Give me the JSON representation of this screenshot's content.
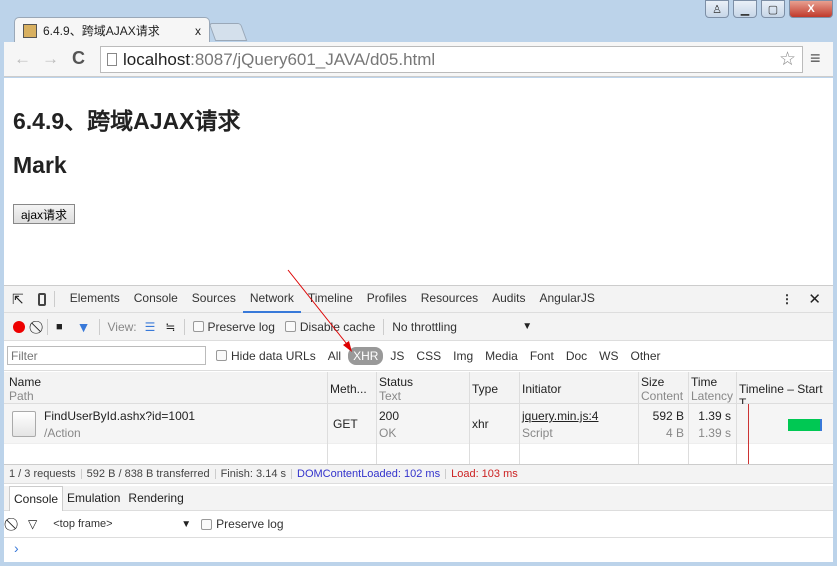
{
  "browser": {
    "tab_title": "6.4.9、跨域AJAX请求",
    "tab_close": "x",
    "url_host": "localhost",
    "url_rest": ":8087/jQuery601_JAVA/d05.html"
  },
  "page": {
    "heading1": "6.4.9、跨域AJAX请求",
    "heading2": "Mark",
    "button": "ajax请求"
  },
  "devtools": {
    "tabs": [
      "Elements",
      "Console",
      "Sources",
      "Network",
      "Timeline",
      "Profiles",
      "Resources",
      "Audits",
      "AngularJS"
    ],
    "active_tab": "Network",
    "view_label": "View:",
    "preserve_log": "Preserve log",
    "disable_cache": "Disable cache",
    "throttling": "No throttling",
    "filter_placeholder": "Filter",
    "hide_data_urls": "Hide data URLs",
    "types": [
      "All",
      "XHR",
      "JS",
      "CSS",
      "Img",
      "Media",
      "Font",
      "Doc",
      "WS",
      "Other"
    ],
    "active_type": "XHR",
    "columns": [
      {
        "main": "Name",
        "sub": "Path"
      },
      {
        "main": "Meth...",
        "sub": ""
      },
      {
        "main": "Status",
        "sub": "Text"
      },
      {
        "main": "Type",
        "sub": ""
      },
      {
        "main": "Initiator",
        "sub": ""
      },
      {
        "main": "Size",
        "sub": "Content"
      },
      {
        "main": "Time",
        "sub": "Latency"
      },
      {
        "main": "Timeline – Start T",
        "sub": ""
      }
    ],
    "rows": [
      {
        "name": "FindUserById.ashx?id=1001",
        "path": "/Action",
        "method": "GET",
        "status": "200",
        "status_text": "OK",
        "type": "xhr",
        "initiator": "jquery.min.js:4",
        "initiator_type": "Script",
        "size": "592 B",
        "content": "4 B",
        "time": "1.39 s",
        "latency": "1.39 s"
      }
    ],
    "status": {
      "requests": "1 / 3 requests",
      "transferred": "592 B / 838 B transferred",
      "finish": "Finish: 3.14 s",
      "dcl": "DOMContentLoaded: 102 ms",
      "load": "Load: 103 ms"
    },
    "drawer_tabs": [
      "Console",
      "Emulation",
      "Rendering"
    ],
    "frame_select": "<top frame>",
    "console_preserve": "Preserve log",
    "prompt": "›"
  },
  "colors": {
    "accent": "#3879d9",
    "dcl": "#3333cc",
    "load": "#cc2222",
    "bar": "#00c853"
  }
}
